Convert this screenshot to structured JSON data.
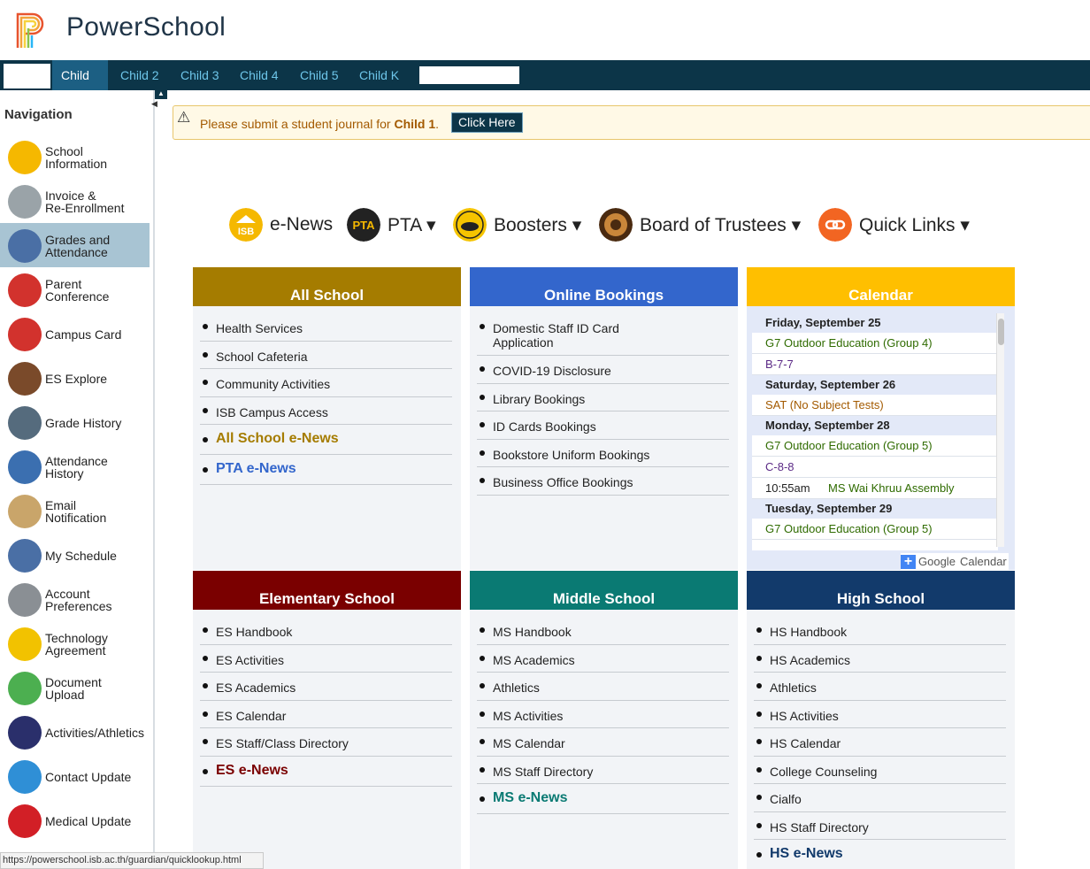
{
  "app": {
    "name": "PowerSchool"
  },
  "tabs": [
    {
      "label": "Child 1",
      "active": true
    },
    {
      "label": "Child 2",
      "active": false
    },
    {
      "label": "Child 3",
      "active": false
    },
    {
      "label": "Child 4",
      "active": false
    },
    {
      "label": "Child 5",
      "active": false
    },
    {
      "label": "Child K",
      "active": false
    }
  ],
  "sidebar": {
    "title": "Navigation",
    "items": [
      {
        "line1": "School",
        "line2": "Information",
        "icon": "isb-info-icon"
      },
      {
        "line1": "Invoice &",
        "line2": "Re-Enrollment",
        "icon": "seal-icon"
      },
      {
        "line1": "Grades and",
        "line2": "Attendance",
        "icon": "grades-checklist-icon",
        "active": true
      },
      {
        "line1": "Parent",
        "line2": "Conference",
        "icon": "parent-conference-icon"
      },
      {
        "line1": "Campus Card",
        "line2": "",
        "icon": "campus-card-icon"
      },
      {
        "line1": "ES Explore",
        "line2": "",
        "icon": "es-explore-icon"
      },
      {
        "line1": "Grade History",
        "line2": "",
        "icon": "grade-history-icon"
      },
      {
        "line1": "Attendance",
        "line2": "History",
        "icon": "attendance-history-icon"
      },
      {
        "line1": "Email",
        "line2": "Notification",
        "icon": "email-icon"
      },
      {
        "line1": "My Schedule",
        "line2": "",
        "icon": "schedule-icon"
      },
      {
        "line1": "Account",
        "line2": "Preferences",
        "icon": "account-icon"
      },
      {
        "line1": "Technology",
        "line2": "Agreement",
        "icon": "lock-icon"
      },
      {
        "line1": "Document",
        "line2": "Upload",
        "icon": "folder-icon"
      },
      {
        "line1": "Activities/Athletics",
        "line2": "",
        "icon": "chq-activities-icon"
      },
      {
        "line1": "Contact Update",
        "line2": "",
        "icon": "home-icon"
      },
      {
        "line1": "Medical Update",
        "line2": "",
        "icon": "medical-cross-icon"
      }
    ]
  },
  "alert": {
    "text_before": "Please submit a student journal for ",
    "child": "Child 1",
    "text_after": ".",
    "button": "Click Here"
  },
  "quick_menu": [
    {
      "label": "e-News",
      "icon": "isb-enews-icon"
    },
    {
      "label": "PTA ▾",
      "icon": "pta-icon"
    },
    {
      "label": "Boosters ▾",
      "icon": "boosters-icon"
    },
    {
      "label": "Board of Trustees ▾",
      "icon": "board-trustees-icon"
    },
    {
      "label": "Quick Links ▾",
      "icon": "quick-links-icon"
    }
  ],
  "panels": {
    "all_school": {
      "title": "All School",
      "color": "#a57c00",
      "items": [
        "Health Services",
        "School Cafeteria",
        "Community Activities",
        "ISB Campus Access"
      ],
      "news": [
        {
          "label": "All School e-News",
          "color": "#a57c00"
        },
        {
          "label": "PTA e-News",
          "color": "#3366cc"
        }
      ]
    },
    "online_bookings": {
      "title": "Online Bookings",
      "color": "#3366cc",
      "items": [
        "Domestic Staff ID Card Application",
        "COVID-19 Disclosure",
        "Library Bookings",
        "ID Cards Bookings",
        "Bookstore Uniform Bookings",
        "Business Office Bookings"
      ]
    },
    "calendar": {
      "title": "Calendar",
      "color": "#ffbf00",
      "days": [
        {
          "date": "Friday, September 25",
          "events": [
            {
              "text": "G7 Outdoor Education (Group 4)",
              "color": "#2f6b00"
            },
            {
              "text": "B-7-7",
              "color": "#5b2a86"
            }
          ]
        },
        {
          "date": "Saturday, September 26",
          "events": [
            {
              "text": "SAT (No Subject Tests)",
              "color": "#a35a00"
            }
          ]
        },
        {
          "date": "Monday, September 28",
          "events": [
            {
              "text": "G7 Outdoor Education (Group 5)",
              "color": "#2f6b00"
            },
            {
              "text": "C-8-8",
              "color": "#5b2a86"
            },
            {
              "time": "10:55am",
              "text": "MS Wai Khruu Assembly",
              "color": "#2f6b00"
            }
          ]
        },
        {
          "date": "Tuesday, September 29",
          "events": [
            {
              "text": "G7 Outdoor Education (Group 5)",
              "color": "#2f6b00"
            }
          ]
        }
      ],
      "google_label": "Google",
      "calendar_label": "Calendar"
    },
    "elementary": {
      "title": "Elementary School",
      "color": "#7a0000",
      "items": [
        "ES Handbook",
        "ES Activities",
        "ES Academics",
        "ES Calendar",
        "ES Staff/Class Directory"
      ],
      "news": [
        {
          "label": "ES e-News",
          "color": "#7a0000"
        }
      ]
    },
    "middle": {
      "title": "Middle School",
      "color": "#0a7a73",
      "items": [
        "MS Handbook",
        "MS Academics",
        "Athletics",
        "MS Activities",
        "MS Calendar",
        "MS Staff Directory"
      ],
      "news": [
        {
          "label": "MS e-News",
          "color": "#0a7a73"
        }
      ]
    },
    "high": {
      "title": "High School",
      "color": "#123a6b",
      "items": [
        "HS Handbook",
        "HS Academics",
        "Athletics",
        "HS Activities",
        "HS Calendar",
        "College Counseling",
        "Cialfo",
        "HS Staff Directory"
      ],
      "news": [
        {
          "label": "HS e-News",
          "color": "#123a6b"
        }
      ]
    }
  },
  "status_bar": "https://powerschool.isb.ac.th/guardian/quicklookup.html"
}
